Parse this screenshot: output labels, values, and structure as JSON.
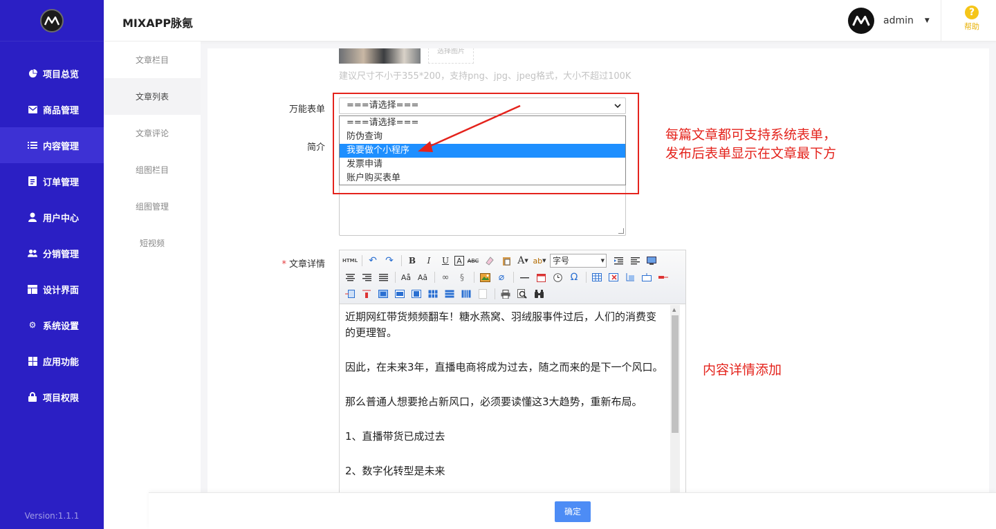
{
  "app": {
    "title": "MIXAPP脉氪",
    "version": "Version:1.1.1"
  },
  "sidebar": {
    "items": [
      {
        "label": "项目总览",
        "icon": "pie-chart-icon"
      },
      {
        "label": "商品管理",
        "icon": "envelope-icon"
      },
      {
        "label": "内容管理",
        "icon": "list-icon"
      },
      {
        "label": "订单管理",
        "icon": "document-icon"
      },
      {
        "label": "用户中心",
        "icon": "user-icon"
      },
      {
        "label": "分销管理",
        "icon": "users-icon"
      },
      {
        "label": "设计界面",
        "icon": "layout-icon"
      },
      {
        "label": "系统设置",
        "icon": "gear-icon"
      },
      {
        "label": "应用功能",
        "icon": "grid-icon"
      },
      {
        "label": "项目权限",
        "icon": "lock-icon"
      }
    ],
    "active_index": 2
  },
  "subnav": {
    "items": [
      "文章栏目",
      "文章列表",
      "文章评论",
      "组图栏目",
      "组图管理",
      "短视频"
    ],
    "active_index": 1
  },
  "header": {
    "user": "admin",
    "help_label": "帮助"
  },
  "form": {
    "image_button": "选择图片",
    "image_hint": "建议尺寸不小于355*200，支持png、jpg、jpeg格式，大小不超过100K",
    "form_label": "万能表单",
    "form_select_value": "===请选择===",
    "form_options": [
      "===请选择===",
      "防伪查询",
      "我要做个小程序",
      "发票申请",
      "账户购买表单"
    ],
    "form_highlighted_index": 2,
    "intro_label": "简介",
    "detail_label": "文章详情",
    "detail_required_mark": "*"
  },
  "editor": {
    "font_size_select": "字号",
    "paragraphs": [
      "近期网红带货频频翻车！糖水燕窝、羽绒服事件过后，人们的消费变的更理智。",
      "因此，在未来3年，直播电商将成为过去，随之而来的是下一个风口。",
      "那么普通人想要抢占新风口，必须要读懂这3大趋势，重新布局。",
      "1、直播带货已成过去",
      "2、数字化转型是未来"
    ]
  },
  "annotations": {
    "form_note_line1": "每篇文章都可支持系统表单，",
    "form_note_line2": "发布后表单显示在文章最下方",
    "detail_note": "内容详情添加",
    "color": "#e4231c"
  },
  "footer": {
    "confirm_label": "确定"
  },
  "colors": {
    "sidebar": "#2b1fc4",
    "primary_button": "#4d8cf5",
    "highlight": "#1e8fff"
  }
}
